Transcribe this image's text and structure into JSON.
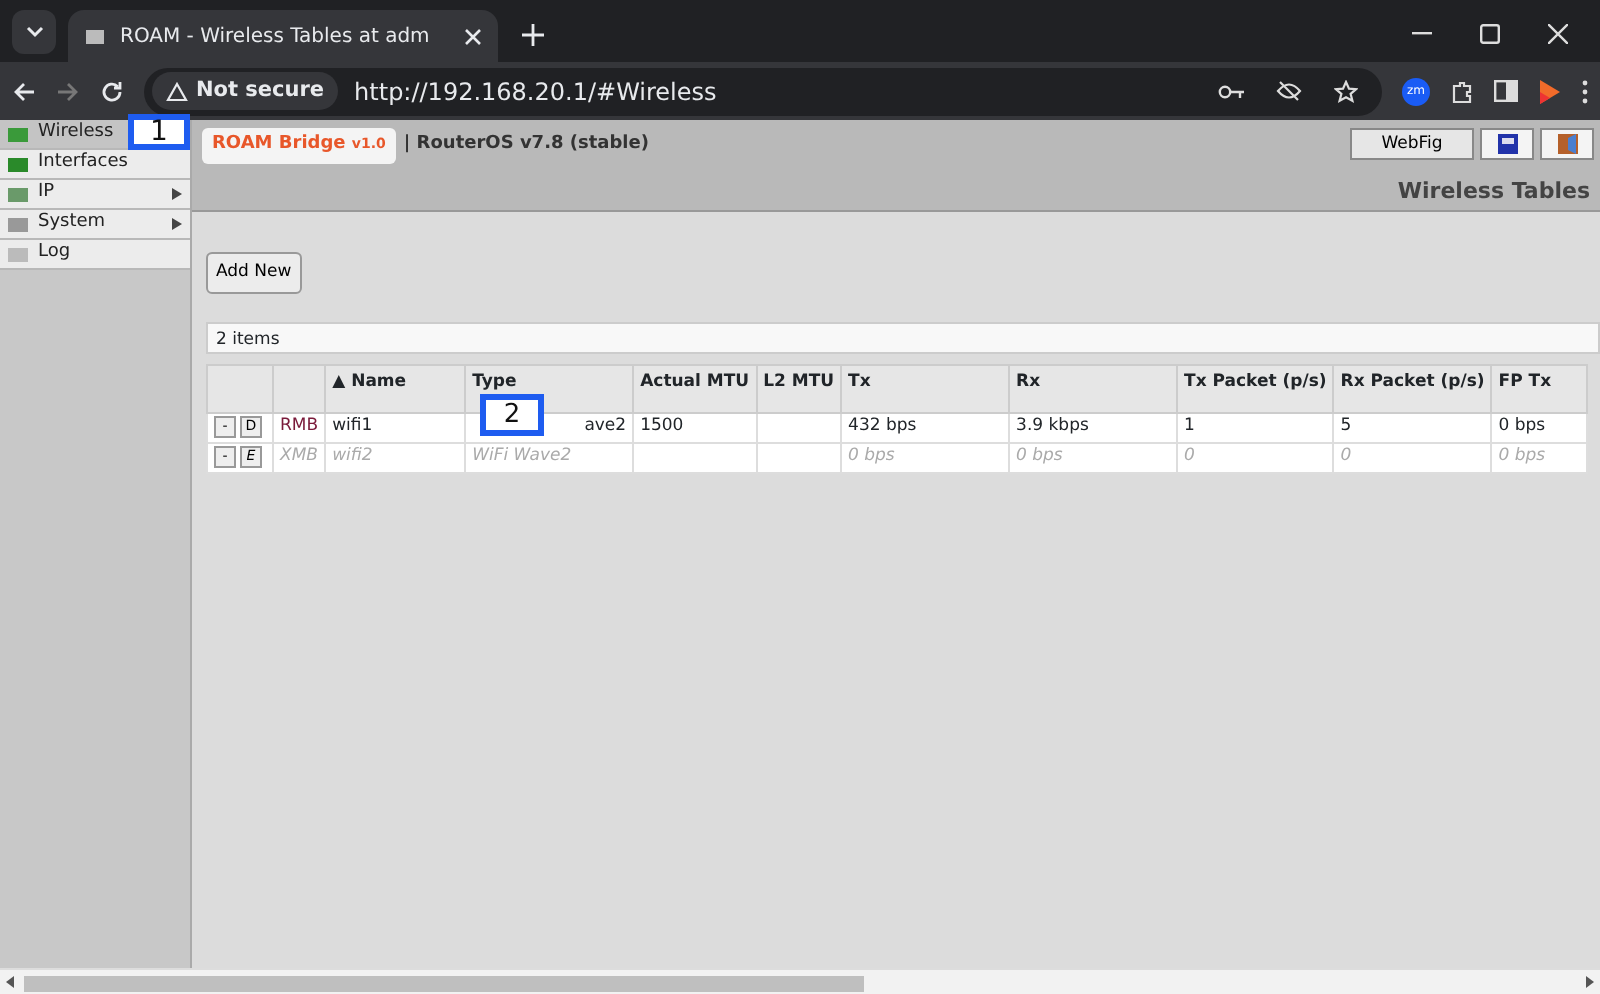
{
  "browser": {
    "tab_title": "ROAM - Wireless Tables at adm",
    "url": "http://192.168.20.1/#Wireless",
    "security": "Not secure",
    "extension_badge": "zm"
  },
  "sidebar": {
    "items": [
      {
        "label": "Wireless",
        "selected": true,
        "submenu": false
      },
      {
        "label": "Interfaces",
        "selected": false,
        "submenu": false
      },
      {
        "label": "IP",
        "selected": false,
        "submenu": true
      },
      {
        "label": "System",
        "selected": false,
        "submenu": true
      },
      {
        "label": "Log",
        "selected": false,
        "submenu": false
      }
    ]
  },
  "header": {
    "brand": "ROAM Bridge",
    "brand_version": "v1.0",
    "os": "| RouterOS v7.8 (stable)",
    "webfig": "WebFig",
    "page_title": "Wireless Tables"
  },
  "toolbar": {
    "add_button": "Add New"
  },
  "table": {
    "count": "2 items",
    "columns": [
      "",
      "▲ Name",
      "Type",
      "Actual MTU",
      "L2 MTU",
      "Tx",
      "Rx",
      "Tx Packet (p/s)",
      "Rx Packet (p/s)",
      "FP Tx"
    ],
    "rows": [
      {
        "remove": "-",
        "toggle": "D",
        "disabled": false,
        "cells": [
          "RMB",
          "wifi1",
          "ave2",
          "1500",
          "",
          "432 bps",
          "3.9 kbps",
          "1",
          "5",
          "0 bps"
        ]
      },
      {
        "remove": "-",
        "toggle": "E",
        "disabled": true,
        "cells": [
          "XMB",
          "wifi2",
          "WiFi Wave2",
          "",
          "",
          "0 bps",
          "0 bps",
          "0",
          "0",
          "0 bps"
        ]
      }
    ]
  },
  "callouts": [
    "1",
    "2"
  ]
}
